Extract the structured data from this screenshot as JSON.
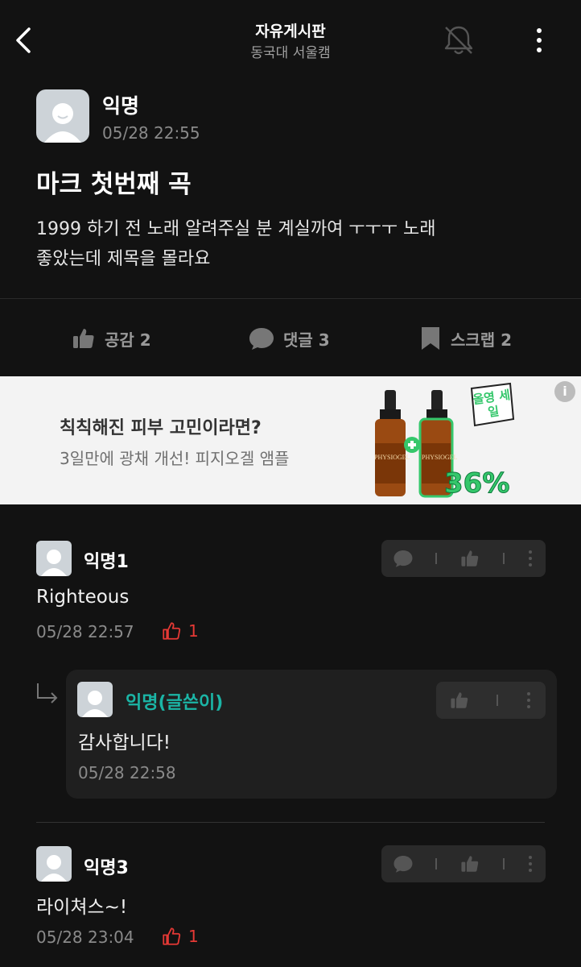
{
  "header": {
    "title": "자유게시판",
    "subtitle": "동국대 서울캠"
  },
  "post": {
    "author": "익명",
    "time": "05/28 22:55",
    "title": "마크 첫번째 곡",
    "body_line1": "1999 하기 전 노래 알려주실 분 계실까여 ㅜㅜㅜ 노래",
    "body_line2": "좋았는데 제목을 몰라요",
    "actions": {
      "like_label": "공감 2",
      "comment_label": "댓글 3",
      "scrap_label": "스크랩 2"
    }
  },
  "ad": {
    "title": "칙칙해진 피부 고민이라면?",
    "subtitle": "3일만에 광채 개선! 피지오겔 앰플",
    "discount": "36%",
    "badge_text": "올영 세일",
    "brand": "PHYSIOGEL",
    "info_icon": "i"
  },
  "comments": [
    {
      "author": "익명1",
      "text": "Righteous",
      "time": "05/28 22:57",
      "likes": "1"
    },
    {
      "author": "익명(글쓴이)",
      "text": "감사합니다!",
      "time": "05/28 22:58",
      "is_reply": true
    },
    {
      "author": "익명3",
      "text": "라이쳐스~!",
      "time": "05/28 23:04",
      "likes": "1"
    }
  ],
  "colors": {
    "background": "#121212",
    "writer_accent": "#1bb5a6",
    "like_red": "#e53935",
    "ad_green": "#35c76b"
  }
}
